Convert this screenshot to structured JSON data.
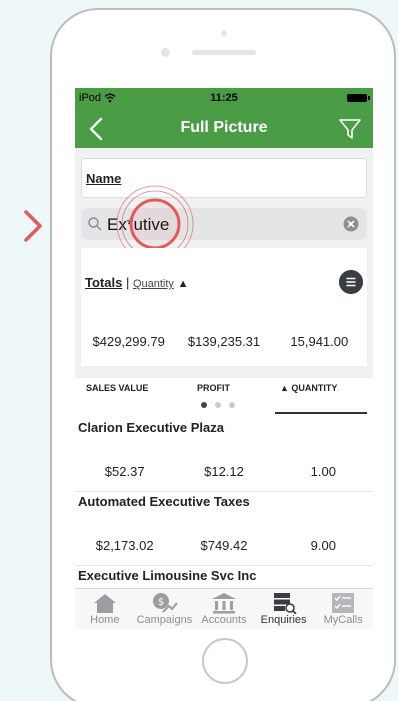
{
  "status_bar": {
    "carrier": "iPod",
    "time": "11:25"
  },
  "nav": {
    "title": "Full Picture"
  },
  "name_field": {
    "label": "Name"
  },
  "search": {
    "value": "Ex*utive"
  },
  "totals": {
    "title": "Totals",
    "separator": "|",
    "sort_label": "Quantity",
    "sort_arrow": "▲",
    "sales_value": "$429,299.79",
    "profit": "$139,235.31",
    "quantity": "15,941.00"
  },
  "columns": {
    "sales_value": "SALES VALUE",
    "profit": "PROFIT",
    "quantity": "▲ QUANTITY"
  },
  "rows": [
    {
      "name": "Clarion Executive Plaza",
      "sales_value": "$52.37",
      "profit": "$12.12",
      "quantity": "1.00"
    },
    {
      "name": "Automated Executive Taxes",
      "sales_value": "$2,173.02",
      "profit": "$749.42",
      "quantity": "9.00"
    },
    {
      "name": "Executive Limousine Svc Inc",
      "sales_value": "",
      "profit": "",
      "quantity": ""
    }
  ],
  "tabs": [
    {
      "label": "Home",
      "icon": "home-icon"
    },
    {
      "label": "Campaigns",
      "icon": "campaigns-icon"
    },
    {
      "label": "Accounts",
      "icon": "bank-icon"
    },
    {
      "label": "Enquiries",
      "icon": "enquiries-icon"
    },
    {
      "label": "MyCalls",
      "icon": "checklist-icon"
    }
  ],
  "active_tab": "Enquiries",
  "colors": {
    "header_green": "#4a9c45",
    "accent_red": "#e45a5a"
  }
}
